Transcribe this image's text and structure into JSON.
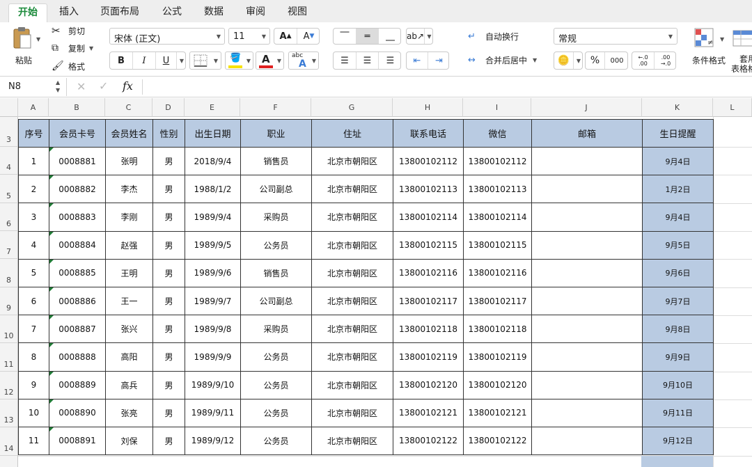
{
  "ribbon_tabs": [
    "开始",
    "插入",
    "页面布局",
    "公式",
    "数据",
    "审阅",
    "视图"
  ],
  "clipboard": {
    "paste": "粘贴",
    "cut": "剪切",
    "copy": "复制",
    "format_painter": "格式"
  },
  "font": {
    "name": "宋体 (正文)",
    "size": "11",
    "bold": "B",
    "italic": "I",
    "underline": "U",
    "font_color_letter": "A",
    "phonetic_top": "abc",
    "phonetic_bottom": "A"
  },
  "alignment": {
    "wrap_text": "自动换行",
    "merge_center": "合并后居中"
  },
  "number": {
    "format": "常规",
    "percent": "%",
    "comma": "000",
    "inc_decimal_top": "←.0",
    "inc_decimal_bottom": ".00",
    "dec_decimal_top": ".00",
    "dec_decimal_bottom": "→.0"
  },
  "styles": {
    "conditional_format": "条件格式",
    "table_format_line1": "套用",
    "table_format_line2": "表格格"
  },
  "formula_bar": {
    "cell_ref": "N8",
    "fx": "fx",
    "value": ""
  },
  "column_headers": [
    "A",
    "B",
    "C",
    "D",
    "E",
    "F",
    "G",
    "H",
    "I",
    "J",
    "K",
    "L"
  ],
  "row_headers": [
    "3",
    "4",
    "5",
    "6",
    "7",
    "8",
    "9",
    "10",
    "11",
    "12",
    "13",
    "14"
  ],
  "colors": {
    "header_fill": "#b9cbe2",
    "active_tab": "#1a8a3a",
    "font_color_bar": "#e02020",
    "fill_color_bar": "#f6e200"
  },
  "table": {
    "headers": [
      "序号",
      "会员卡号",
      "会员姓名",
      "性别",
      "出生日期",
      "职业",
      "住址",
      "联系电话",
      "微信",
      "邮箱",
      "生日提醒"
    ],
    "rows": [
      [
        "1",
        "0008881",
        "张明",
        "男",
        "2018/9/4",
        "销售员",
        "北京市朝阳区",
        "13800102112",
        "13800102112",
        "",
        "9月4日"
      ],
      [
        "2",
        "0008882",
        "李杰",
        "男",
        "1988/1/2",
        "公司副总",
        "北京市朝阳区",
        "13800102113",
        "13800102113",
        "",
        "1月2日"
      ],
      [
        "3",
        "0008883",
        "李刚",
        "男",
        "1989/9/4",
        "采购员",
        "北京市朝阳区",
        "13800102114",
        "13800102114",
        "",
        "9月4日"
      ],
      [
        "4",
        "0008884",
        "赵强",
        "男",
        "1989/9/5",
        "公务员",
        "北京市朝阳区",
        "13800102115",
        "13800102115",
        "",
        "9月5日"
      ],
      [
        "5",
        "0008885",
        "王明",
        "男",
        "1989/9/6",
        "销售员",
        "北京市朝阳区",
        "13800102116",
        "13800102116",
        "",
        "9月6日"
      ],
      [
        "6",
        "0008886",
        "王一",
        "男",
        "1989/9/7",
        "公司副总",
        "北京市朝阳区",
        "13800102117",
        "13800102117",
        "",
        "9月7日"
      ],
      [
        "7",
        "0008887",
        "张兴",
        "男",
        "1989/9/8",
        "采购员",
        "北京市朝阳区",
        "13800102118",
        "13800102118",
        "",
        "9月8日"
      ],
      [
        "8",
        "0008888",
        "高阳",
        "男",
        "1989/9/9",
        "公务员",
        "北京市朝阳区",
        "13800102119",
        "13800102119",
        "",
        "9月9日"
      ],
      [
        "9",
        "0008889",
        "高兵",
        "男",
        "1989/9/10",
        "公务员",
        "北京市朝阳区",
        "13800102120",
        "13800102120",
        "",
        "9月10日"
      ],
      [
        "10",
        "0008890",
        "张亮",
        "男",
        "1989/9/11",
        "公务员",
        "北京市朝阳区",
        "13800102121",
        "13800102121",
        "",
        "9月11日"
      ],
      [
        "11",
        "0008891",
        "刘保",
        "男",
        "1989/9/12",
        "公务员",
        "北京市朝阳区",
        "13800102122",
        "13800102122",
        "",
        "9月12日"
      ]
    ]
  }
}
